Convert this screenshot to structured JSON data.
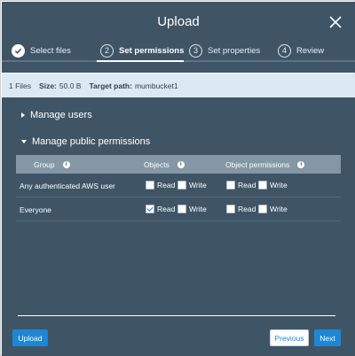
{
  "dialog": {
    "title": "Upload"
  },
  "steps": [
    {
      "number": "1",
      "label": "Select files",
      "done": true
    },
    {
      "number": "2",
      "label": "Set permissions"
    },
    {
      "number": "3",
      "label": "Set properties"
    },
    {
      "number": "4",
      "label": "Review"
    }
  ],
  "info": {
    "files": "1 Files",
    "size_label": "Size:",
    "size_value": "50.0 B",
    "target_label": "Target path:",
    "target_value": "mumbucket1"
  },
  "sections": {
    "manage_users": "Manage users",
    "manage_public": "Manage public permissions"
  },
  "table": {
    "headers": {
      "group": "Group",
      "objects": "Objects",
      "object_permissions": "Object permissions"
    },
    "rows": [
      {
        "group": "Any authenticated AWS user",
        "objects_read": {
          "label": "Read",
          "checked": false
        },
        "objects_write": {
          "label": "Write",
          "checked": false
        },
        "perm_read": {
          "label": "Read",
          "checked": false
        },
        "perm_write": {
          "label": "Write",
          "checked": false
        }
      },
      {
        "group": "Everyone",
        "objects_read": {
          "label": "Read",
          "checked": true
        },
        "objects_write": {
          "label": "Write",
          "checked": false
        },
        "perm_read": {
          "label": "Read",
          "checked": false
        },
        "perm_write": {
          "label": "Write",
          "checked": false
        }
      }
    ]
  },
  "buttons": {
    "upload": "Upload",
    "previous": "Previous",
    "next": "Next"
  },
  "colors": {
    "panel": "#3f5566",
    "accent": "#1f86d4",
    "infobar": "#dde9f2"
  }
}
